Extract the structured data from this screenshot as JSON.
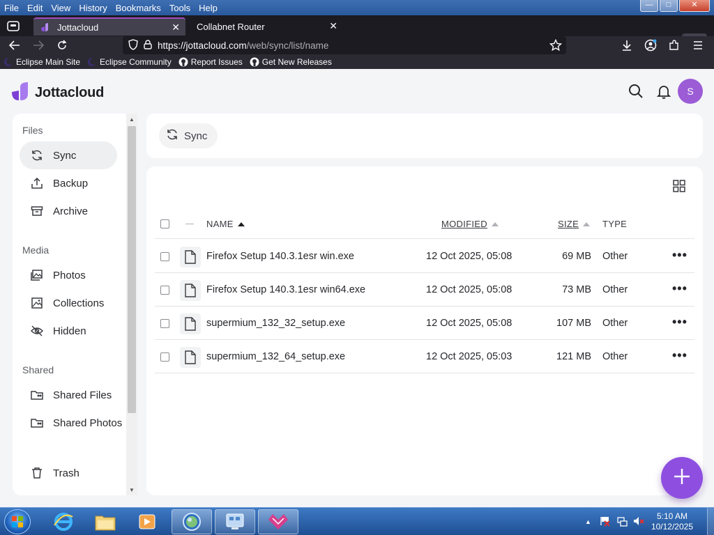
{
  "window": {
    "menu": [
      "File",
      "Edit",
      "View",
      "History",
      "Bookmarks",
      "Tools",
      "Help"
    ],
    "controls": {
      "minimize": "—",
      "maximize": "□",
      "close": "✕"
    }
  },
  "browser": {
    "tabs": [
      {
        "title": "Jottacloud",
        "active": true
      },
      {
        "title": "Collabnet Router",
        "active": false
      }
    ],
    "new_tab": "+",
    "tab_count": "2",
    "url": {
      "host": "https://jottacloud.com",
      "path": "/web/sync/list/name"
    },
    "bookmarks": [
      "Eclipse Main Site",
      "Eclipse Community",
      "Report Issues",
      "Get New Releases"
    ]
  },
  "app": {
    "name": "Jottacloud",
    "avatar_initial": "S",
    "brand_color": "#8e4fe0"
  },
  "sidebar": {
    "sections": [
      {
        "title": "Files",
        "items": [
          {
            "label": "Sync",
            "icon": "sync-icon",
            "active": true
          },
          {
            "label": "Backup",
            "icon": "backup-icon"
          },
          {
            "label": "Archive",
            "icon": "archive-icon"
          }
        ]
      },
      {
        "title": "Media",
        "items": [
          {
            "label": "Photos",
            "icon": "photos-icon"
          },
          {
            "label": "Collections",
            "icon": "collections-icon"
          },
          {
            "label": "Hidden",
            "icon": "hidden-icon"
          }
        ]
      },
      {
        "title": "Shared",
        "items": [
          {
            "label": "Shared Files",
            "icon": "shared-files-icon"
          },
          {
            "label": "Shared Photos",
            "icon": "shared-photos-icon"
          }
        ]
      }
    ],
    "trash_label": "Trash"
  },
  "toolbar": {
    "chip_label": "Sync"
  },
  "table": {
    "headers": {
      "name": "NAME",
      "modified": "MODIFIED",
      "size": "SIZE",
      "type": "TYPE"
    },
    "rows": [
      {
        "name": "Firefox Setup 140.3.1esr win.exe",
        "modified": "12 Oct 2025, 05:08",
        "size": "69 MB",
        "type": "Other"
      },
      {
        "name": "Firefox Setup 140.3.1esr win64.exe",
        "modified": "12 Oct 2025, 05:08",
        "size": "73 MB",
        "type": "Other"
      },
      {
        "name": "supermium_132_32_setup.exe",
        "modified": "12 Oct 2025, 05:08",
        "size": "107 MB",
        "type": "Other"
      },
      {
        "name": "supermium_132_64_setup.exe",
        "modified": "12 Oct 2025, 05:03",
        "size": "121 MB",
        "type": "Other"
      }
    ],
    "more_label": "•••"
  },
  "taskbar": {
    "time": "5:10 AM",
    "date": "10/12/2025"
  }
}
